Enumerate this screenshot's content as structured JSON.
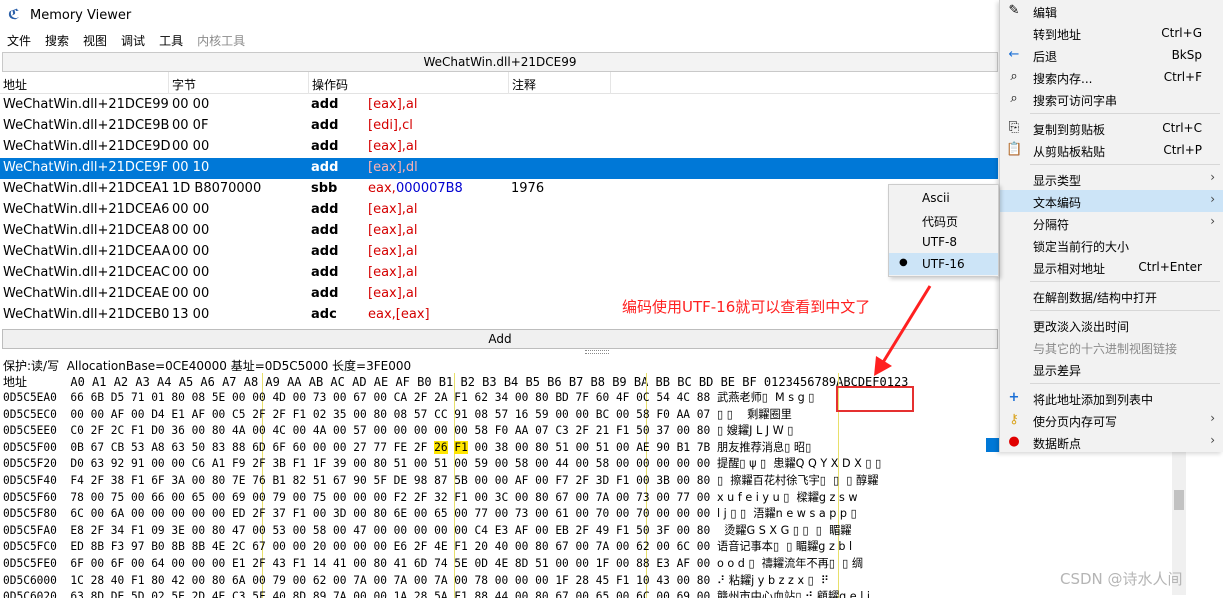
{
  "window": {
    "title": "Memory Viewer",
    "icon": "cheat-engine-icon"
  },
  "menubar": [
    "文件",
    "搜索",
    "视图",
    "调试",
    "工具",
    "内核工具"
  ],
  "disasm": {
    "header": "WeChatWin.dll+21DCE99",
    "columns": [
      "地址",
      "字节",
      "操作码",
      "注释"
    ],
    "rows": [
      {
        "addr": "WeChatWin.dll+21DCE99",
        "bytes": "00 00",
        "op": "add",
        "args": "[eax],al",
        "comment": ""
      },
      {
        "addr": "WeChatWin.dll+21DCE9B",
        "bytes": "00 0F",
        "op": "add",
        "args": "[edi],cl",
        "comment": ""
      },
      {
        "addr": "WeChatWin.dll+21DCE9D",
        "bytes": "00 00",
        "op": "add",
        "args": "[eax],al",
        "comment": ""
      },
      {
        "addr": "WeChatWin.dll+21DCE9F",
        "bytes": "00 10",
        "op": "add",
        "args": "[eax],dl",
        "comment": ""
      },
      {
        "addr": "WeChatWin.dll+21DCEA1",
        "bytes": "1D B8070000",
        "op": "sbb",
        "args_a": "eax,",
        "args_b": "000007B8",
        "comment": "1976"
      },
      {
        "addr": "WeChatWin.dll+21DCEA6",
        "bytes": "00 00",
        "op": "add",
        "args": "[eax],al",
        "comment": ""
      },
      {
        "addr": "WeChatWin.dll+21DCEA8",
        "bytes": "00 00",
        "op": "add",
        "args": "[eax],al",
        "comment": ""
      },
      {
        "addr": "WeChatWin.dll+21DCEAA",
        "bytes": "00 00",
        "op": "add",
        "args": "[eax],al",
        "comment": ""
      },
      {
        "addr": "WeChatWin.dll+21DCEAC",
        "bytes": "00 00",
        "op": "add",
        "args": "[eax],al",
        "comment": ""
      },
      {
        "addr": "WeChatWin.dll+21DCEAE",
        "bytes": "00 00",
        "op": "add",
        "args": "[eax],al",
        "comment": ""
      },
      {
        "addr": "WeChatWin.dll+21DCEB0",
        "bytes": "13 00",
        "op": "adc",
        "args": "eax,[eax]",
        "comment": ""
      }
    ],
    "add_label": "Add"
  },
  "hex": {
    "protect_line": "保护:读/写  AllocationBase=0CE40000 基址=0D5C5000 长度=3FE000",
    "header": "地址      A0 A1 A2 A3 A4 A5 A6 A7 A8 A9 AA AB AC AD AE AF B0 B1 B2 B3 B4 B5 B6 B7 B8 B9 BA BB BC BD BE BF 0123456789ABCDEF0123",
    "rows": [
      {
        "addr": "0D5C5EA0",
        "bytes": "66 6B D5 71 01 80 08 5E 00 00 4D 00 73 00 67 00 CA 2F 2A F1 62 34 00 80 BD 7F 60 4F 0C 54 4C 88",
        "text": "武燕老师▯  M s g ▯"
      },
      {
        "addr": "0D5C5EC0",
        "bytes": "00 00 AF 00 D4 E1 AF 00 C5 2F 2F F1 02 35 00 80 08 57 CC 91 08 57 16 59 00 00 BC 00 58 F0 AA 07",
        "text": "▯ ▯    剩糶圈里"
      },
      {
        "addr": "0D5C5EE0",
        "bytes": "C0 2F 2C F1 D0 36 00 80 4A 00 4C 00 4A 00 57 00 00 00 00 00 58 F0 AA 07 C3 2F 21 F1 50 37 00 80",
        "text": "▯ 嫂糶J L J W ▯"
      },
      {
        "addr": "0D5C5F00",
        "bytes": "0B 67 CB 53 A8 63 50 83 88 6D 6F 60 00 00 27 77 FE 2F 26 F1 00 38 00 80 51 00 51 00 AE 90 B1 7B",
        "text": "朋友推荐消息▯ 昭▯"
      },
      {
        "addr": "0D5C5F20",
        "bytes": "D0 63 92 91 00 00 C6 A1 F9 2F 3B F1 1F 39 00 80 51 00 51 00 59 00 58 00 44 00 58 00 00 00 00 00",
        "text": "提醒▯ ψ ▯  患糶Q Q Y X D X ▯ ▯"
      },
      {
        "addr": "0D5C5F40",
        "bytes": "F4 2F 38 F1 6F 3A 00 80 7E 76 B1 82 51 67 90 5F DE 98 87 5B 00 00 AF 00 F7 2F 3D F1 00 3B 00 80",
        "text": "▯  擦糶百花村徐飞宇▯  ▯  ▯ 醇糶"
      },
      {
        "addr": "0D5C5F60",
        "bytes": "78 00 75 00 66 00 65 00 69 00 79 00 75 00 00 00 F2 2F 32 F1 00 3C 00 80 67 00 7A 00 73 00 77 00",
        "text": "x u f e i y u ▯  樑糶g z s w"
      },
      {
        "addr": "0D5C5F80",
        "bytes": "6C 00 6A 00 00 00 00 00 ED 2F 37 F1 00 3D 00 80 6E 00 65 00 77 00 73 00 61 00 70 00 70 00 00 00",
        "text": "l j ▯ ▯  浯糶n e w s a p p ▯"
      },
      {
        "addr": "0D5C5FA0",
        "bytes": "E8 2F 34 F1 09 3E 00 80 47 00 53 00 58 00 47 00 00 00 00 00 C4 E3 AF 00 EB 2F 49 F1 50 3F 00 80",
        "text": "  烫糶G S X G ▯ ▯  ▯  睸糶"
      },
      {
        "addr": "0D5C5FC0",
        "bytes": "ED 8B F3 97 B0 8B 8B 4E 2C 67 00 00 20 00 00 00 E6 2F 4E F1 20 40 00 80 67 00 7A 00 62 00 6C 00",
        "text": "语音记事本▯  ▯ 睸糶g z b l"
      },
      {
        "addr": "0D5C5FE0",
        "bytes": "6F 00 6F 00 64 00 00 00 E1 2F 43 F1 14 41 00 80 41 6D 74 5E 0D 4E 8D 51 00 00 1F 00 88 E3 AF 00",
        "text": "o o d ▯  禱糶流年不再▯  ▯ 绸"
      },
      {
        "addr": "0D5C6000",
        "bytes": "1C 28 40 F1 80 42 00 80 6A 00 79 00 62 00 7A 00 7A 00 7A 00 78 00 00 00 1F 28 45 F1 10 43 00 80",
        "text": "⠜ 粘糶j y b z z x ▯  ⠟  "
      },
      {
        "addr": "0D5C6020",
        "bytes": "63 8D DE 5D 02 5E 2D 4E C3 5F 40 8D 89 7A 00 00 1A 28 5A F1 88 44 00 80 67 00 65 00 6C 00 69 00",
        "text": "赣州市中心血站▯ ⠚ 顧糶g e l i"
      }
    ]
  },
  "annotation": {
    "text": "编码使用UTF-16就可以查看到中文了",
    "color": "#ff2020"
  },
  "context_menu": {
    "items": [
      {
        "label": "编辑",
        "shortcut": "",
        "icon": "edit-icon",
        "submenu": false,
        "disabled": false
      },
      {
        "label": "转到地址",
        "shortcut": "Ctrl+G",
        "icon": "",
        "submenu": false,
        "disabled": false
      },
      {
        "label": "后退",
        "shortcut": "BkSp",
        "icon": "back-arrow-icon",
        "submenu": false,
        "disabled": false
      },
      {
        "label": "搜索内存...",
        "shortcut": "Ctrl+F",
        "icon": "search-icon",
        "submenu": false,
        "disabled": false
      },
      {
        "label": "搜索可访问字串",
        "shortcut": "",
        "icon": "search-icon",
        "submenu": false,
        "disabled": false
      },
      {
        "label": "复制到剪贴板",
        "shortcut": "Ctrl+C",
        "icon": "copy-icon",
        "submenu": false,
        "disabled": false
      },
      {
        "label": "从剪贴板粘贴",
        "shortcut": "Ctrl+P",
        "icon": "paste-icon",
        "submenu": false,
        "disabled": false
      },
      {
        "label": "显示类型",
        "shortcut": "",
        "icon": "",
        "submenu": true,
        "disabled": false
      },
      {
        "label": "文本编码",
        "shortcut": "",
        "icon": "",
        "submenu": true,
        "disabled": false
      },
      {
        "label": "分隔符",
        "shortcut": "",
        "icon": "",
        "submenu": true,
        "disabled": false
      },
      {
        "label": "锁定当前行的大小",
        "shortcut": "",
        "icon": "",
        "submenu": false,
        "disabled": false
      },
      {
        "label": "显示相对地址",
        "shortcut": "Ctrl+Enter",
        "icon": "",
        "submenu": false,
        "disabled": false
      },
      {
        "label": "在解剖数据/结构中打开",
        "shortcut": "",
        "icon": "",
        "submenu": false,
        "disabled": false
      },
      {
        "label": "更改淡入淡出时间",
        "shortcut": "",
        "icon": "",
        "submenu": false,
        "disabled": false
      },
      {
        "label": "与其它的十六进制视图链接",
        "shortcut": "",
        "icon": "",
        "submenu": false,
        "disabled": true
      },
      {
        "label": "显示差异",
        "shortcut": "",
        "icon": "",
        "submenu": false,
        "disabled": false
      },
      {
        "label": "将此地址添加到列表中",
        "shortcut": "",
        "icon": "plus-icon",
        "submenu": false,
        "disabled": false
      },
      {
        "label": "使分页内存可写",
        "shortcut": "",
        "icon": "key-icon",
        "submenu": true,
        "disabled": false
      },
      {
        "label": "数据断点",
        "shortcut": "",
        "icon": "red-dot-icon",
        "submenu": true,
        "disabled": false
      }
    ]
  },
  "encoding_submenu": {
    "items": [
      "Ascii",
      "代码页",
      "UTF-8",
      "UTF-16"
    ],
    "selected": "UTF-16"
  },
  "watermark": "CSDN @诗水人间",
  "colors": {
    "selection": "#0078d7",
    "highlight": "#ffe600",
    "annotation": "#ff2020",
    "menu_hover": "#cce4f7"
  }
}
